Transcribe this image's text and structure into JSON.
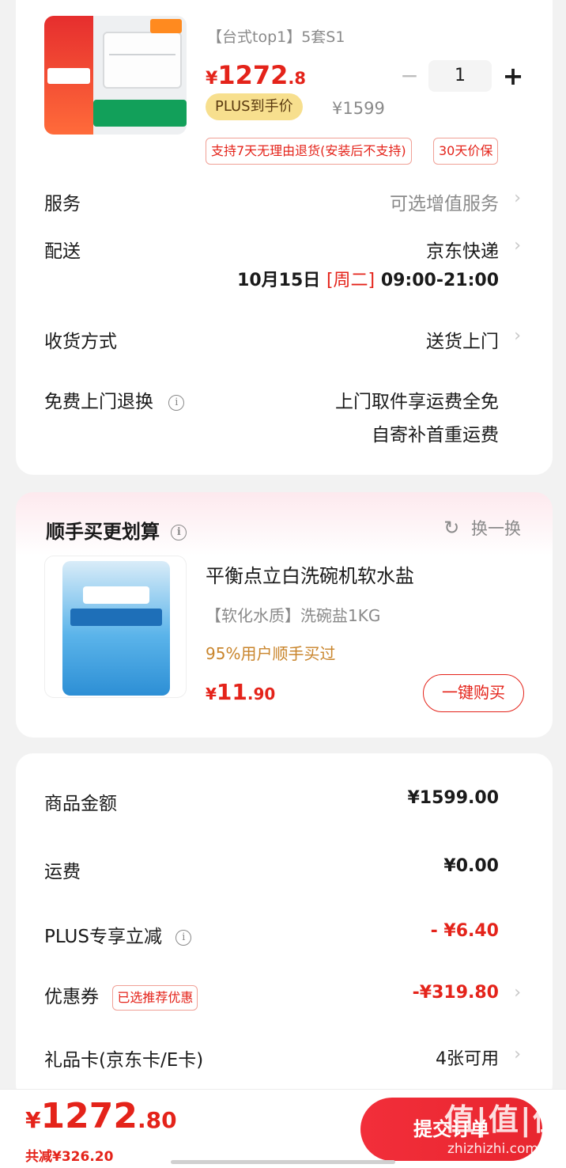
{
  "product": {
    "subtitle": "【台式top1】5套S1",
    "price_symbol": "¥",
    "price_int": "1272",
    "price_dec": ".8",
    "quantity": "1",
    "minus_label": "−",
    "plus_label": "+",
    "plus_badge": "PLUS到手价",
    "original_price": "¥1599",
    "service_tags": [
      "支持7天无理由退货(安装后不支持)",
      "30天价保"
    ]
  },
  "rows": {
    "service_label": "服务",
    "service_value": "可选增值服务",
    "delivery_label": "配送",
    "delivery_value": "京东快递",
    "delivery_date": "10月15日",
    "delivery_weekday": "[周二]",
    "delivery_time": "09:00-21:00",
    "receive_label": "收货方式",
    "receive_value": "送货上门",
    "return_label": "免费上门退换",
    "return_value_1": "上门取件享运费全免",
    "return_value_2": "自寄补首重运费"
  },
  "recommend": {
    "title": "顺手买更划算",
    "switch_label": "换一换",
    "name": "平衡点立白洗碗机软水盐",
    "sub": "【软化水质】洗碗盐1KG",
    "social": "95%用户顺手买过",
    "price_symbol": "¥",
    "price_int": "11",
    "price_dec": ".90",
    "buy_label": "一键购买"
  },
  "summary": {
    "goods_label": "商品金额",
    "goods_value": "¥1599.00",
    "shipping_label": "运费",
    "shipping_value": "¥0.00",
    "plus_label": "PLUS专享立减",
    "plus_value": "- ¥6.40",
    "coupon_label": "优惠券",
    "coupon_tag": "已选推荐优惠",
    "coupon_value": "-¥319.80",
    "giftcard_label": "礼品卡(京东卡/E卡)",
    "giftcard_value": "4张可用"
  },
  "bottom": {
    "total_symbol": "¥",
    "total_int": "1272",
    "total_dec": ".80",
    "saved": "共减¥326.20",
    "submit_label": "提交订单",
    "watermark": "值|值|值",
    "watermark_url": "zhizhizhi.com"
  },
  "icons": {
    "chevron": "›",
    "info": "i",
    "refresh": "↻"
  },
  "colors": {
    "accent_red": "#e4231a",
    "plus_gold": "#f7df8e",
    "social_orange": "#c9852c"
  }
}
